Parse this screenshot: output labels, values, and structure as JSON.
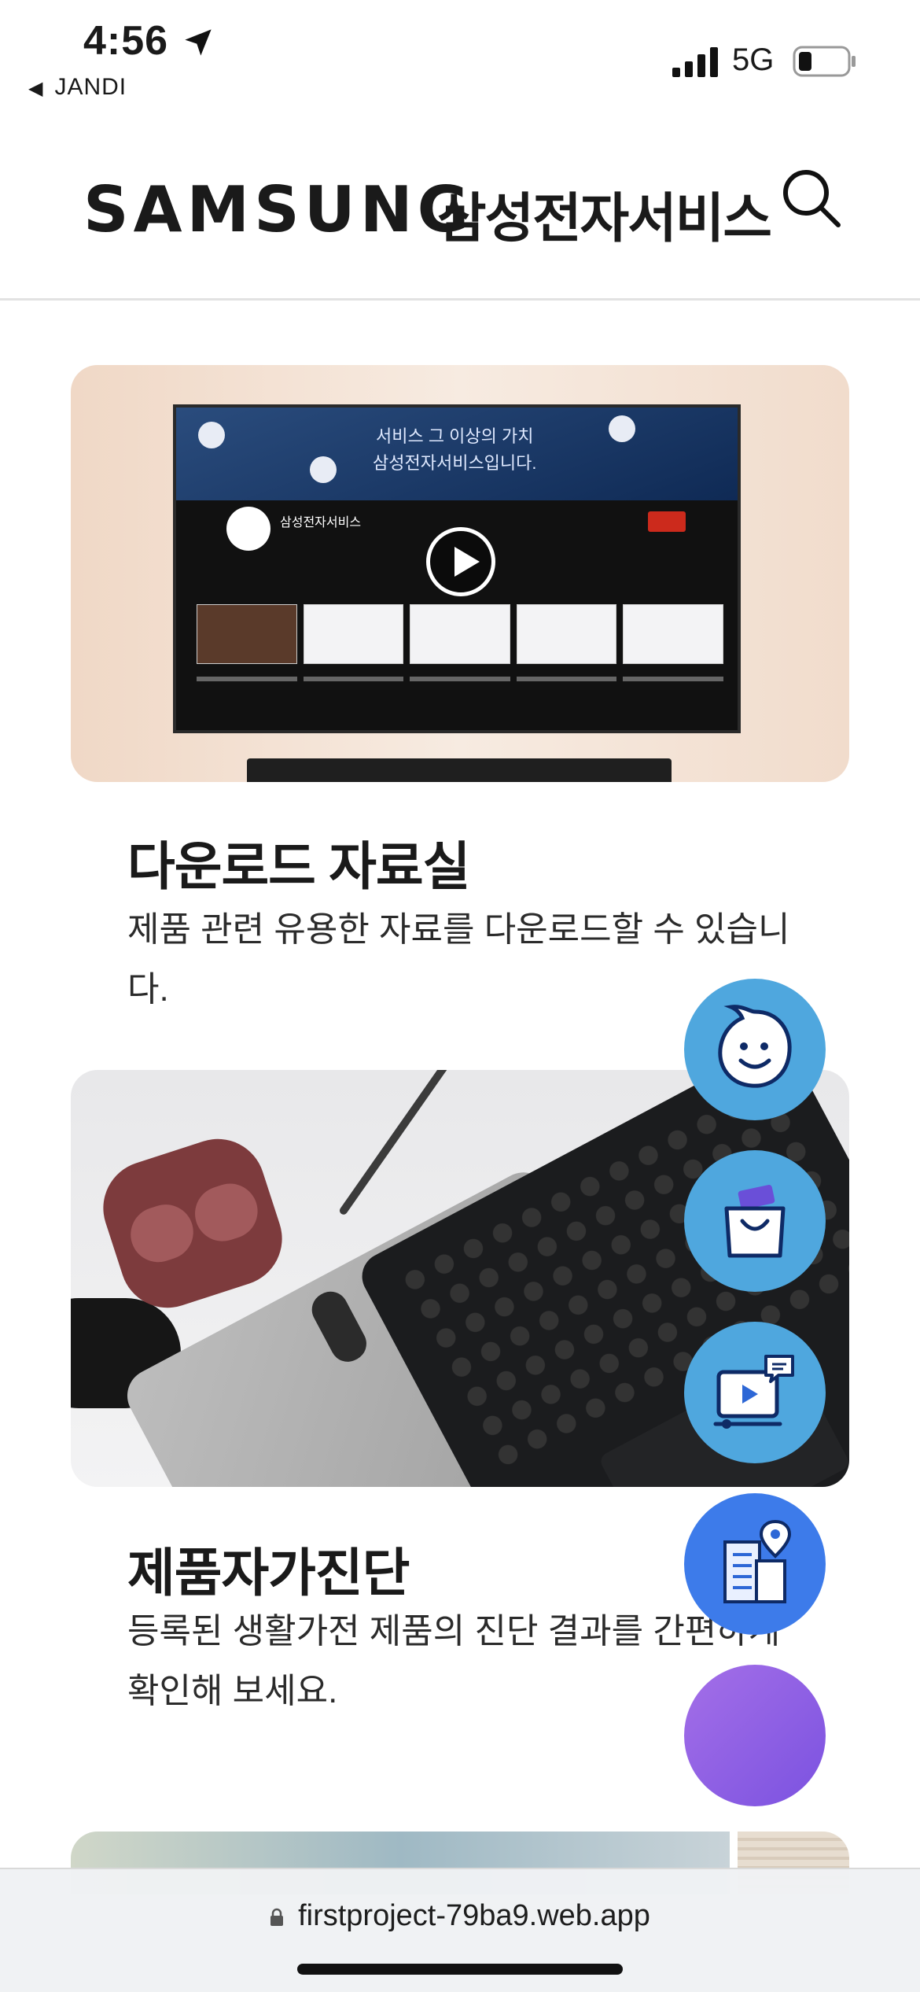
{
  "status_bar": {
    "time": "4:56",
    "back_app": "JANDI",
    "network": "5G"
  },
  "header": {
    "brand": "SAMSUNG",
    "brand_sub": "삼성전자서비스"
  },
  "cards": [
    {
      "title": "다운로드 자료실",
      "description": "제품 관련 유용한 자료를 다운로드할 수 있습니다.",
      "banner_text": "서비스 그 이상의 가치\n삼성전자서비스입니다.",
      "channel_name": "삼성전자서비스"
    },
    {
      "title": "제품자가진단",
      "description": "등록된 생활가전 제품의 진단 결과를 간편하게 확인해 보세요."
    }
  ],
  "fabs": [
    {
      "icon": "chatbot-face-icon"
    },
    {
      "icon": "shopping-bag-icon"
    },
    {
      "icon": "video-chat-icon"
    },
    {
      "icon": "service-center-icon"
    },
    {
      "icon": "blank-icon"
    }
  ],
  "browser": {
    "url": "firstproject-79ba9.web.app"
  },
  "colors": {
    "fab_light_blue": "#4fa7de",
    "fab_blue": "#3d7bea",
    "fab_purple": "#8a5ce4"
  }
}
